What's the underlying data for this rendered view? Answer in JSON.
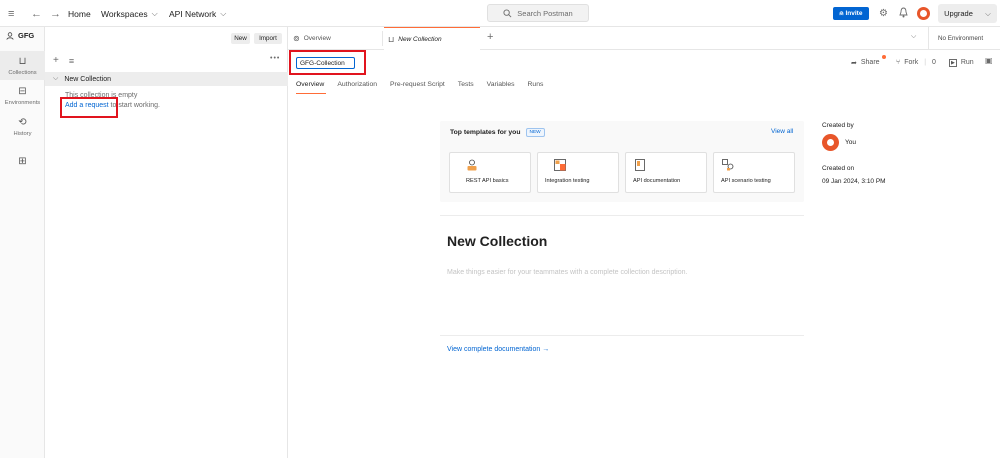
{
  "topbar": {
    "home": "Home",
    "workspaces": "Workspaces",
    "api_network": "API Network",
    "search_placeholder": "Search Postman",
    "invite": "Invite",
    "upgrade": "Upgrade"
  },
  "workspace": {
    "name": "GFG",
    "new_label": "New",
    "import_label": "Import"
  },
  "rail": {
    "items": [
      {
        "label": "Collections",
        "icon": "collections-icon"
      },
      {
        "label": "Environments",
        "icon": "environments-icon"
      },
      {
        "label": "History",
        "icon": "history-icon"
      },
      {
        "label": "",
        "icon": "apps-icon"
      }
    ]
  },
  "sidebar": {
    "collection_name": "New Collection",
    "empty_text": "This collection is empty",
    "add_request_link": "Add a request",
    "add_request_suffix": " to start working."
  },
  "tabs": {
    "overview": "Overview",
    "new_collection": "New Collection",
    "environment": "No Environment"
  },
  "request": {
    "collection_name_value": "GFG-Collection",
    "share": "Share",
    "fork": "Fork",
    "fork_count": "0",
    "run": "Run",
    "sub_tabs": [
      "Overview",
      "Authorization",
      "Pre-request Script",
      "Tests",
      "Variables",
      "Runs"
    ]
  },
  "templates": {
    "title": "Top templates for you",
    "badge": "NEW",
    "view_all": "View all",
    "items": [
      {
        "label": "REST API basics",
        "icon": "rest-api-icon",
        "color": "#f0a04b"
      },
      {
        "label": "Integration testing",
        "icon": "integration-icon",
        "color": "#ff6c37"
      },
      {
        "label": "API documentation",
        "icon": "documentation-icon",
        "color": "#6b6b6b"
      },
      {
        "label": "API scenario testing",
        "icon": "scenario-icon",
        "color": "#6b6b6b"
      }
    ]
  },
  "main": {
    "title": "New Collection",
    "description_placeholder": "Make things easier for your teammates with a complete collection description.",
    "view_docs": "View complete documentation →"
  },
  "info": {
    "created_by_label": "Created by",
    "created_by_value": "You",
    "created_on_label": "Created on",
    "created_on_value": "09 Jan 2024, 3:10 PM"
  },
  "colors": {
    "accent": "#ff6c37",
    "link": "#0265d2",
    "highlight": "#e1141e"
  }
}
